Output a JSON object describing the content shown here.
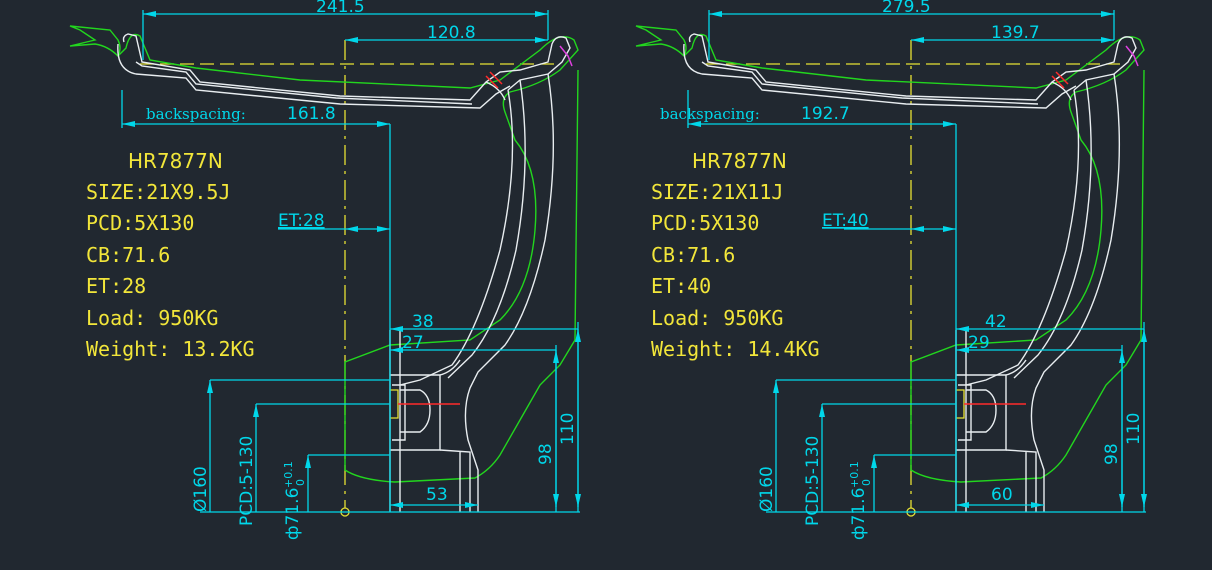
{
  "drawings": [
    {
      "model": "HR7877N",
      "size": "SIZE:21X9.5J",
      "pcd": "PCD:5X130",
      "cb": "CB:71.6",
      "et": "ET:28",
      "load": "Load: 950KG",
      "weight": "Weight: 13.2KG",
      "dims": {
        "overall_width": "241.5",
        "half_width": "120.8",
        "backspacing_label": "backspacing:",
        "backspacing": "161.8",
        "et_dim": "ET:28",
        "flange_a": "38",
        "flange_b": "27",
        "hub_width": "53",
        "height_98": "98",
        "height_110": "110",
        "dia_160": "Ø160",
        "pcd_v": "PCD:5-130",
        "cb_v": "ф71.6",
        "cb_tol_up": "+0.1",
        "cb_tol_down": "0"
      }
    },
    {
      "model": "HR7877N",
      "size": "SIZE:21X11J",
      "pcd": "PCD:5X130",
      "cb": "CB:71.6",
      "et": "ET:40",
      "load": "Load: 950KG",
      "weight": "Weight: 14.4KG",
      "dims": {
        "overall_width": "279.5",
        "half_width": "139.7",
        "backspacing_label": "backspacing:",
        "backspacing": "192.7",
        "et_dim": "ET:40",
        "flange_a": "42",
        "flange_b": "29",
        "hub_width": "60",
        "height_98": "98",
        "height_110": "110",
        "dia_160": "Ø160",
        "pcd_v": "PCD:5-130",
        "cb_v": "ф71.6",
        "cb_tol_up": "+0.1",
        "cb_tol_down": "0"
      }
    }
  ],
  "colors": {
    "background": "#212830",
    "dimension": "#00d7ea",
    "spec_text": "#f2e63a",
    "outline": "#22d61e",
    "profile": "#e8edf0"
  }
}
